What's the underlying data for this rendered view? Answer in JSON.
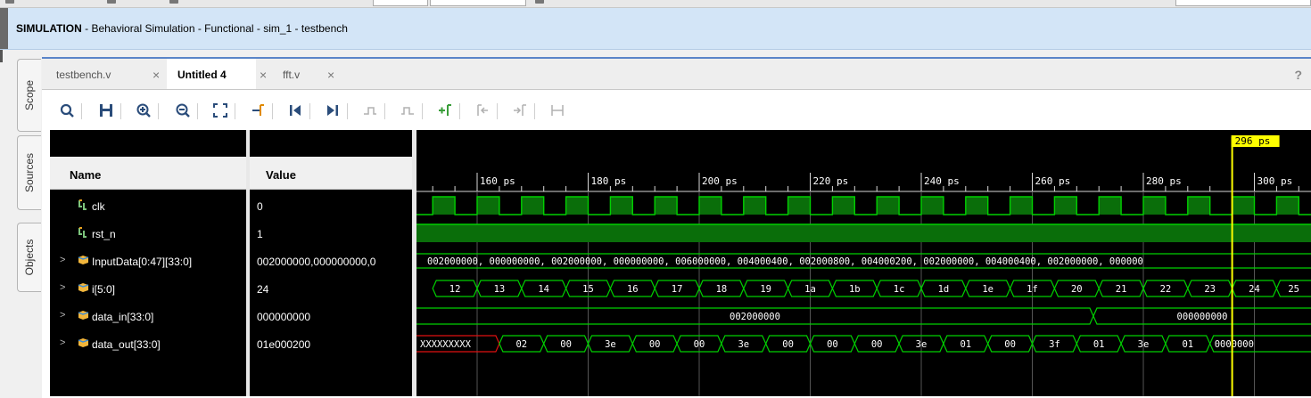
{
  "header": {
    "title_bold": "SIMULATION",
    "title_rest": " - Behavioral Simulation - Functional - sim_1 - testbench"
  },
  "side_tabs": [
    "Scope",
    "Sources",
    "Objects"
  ],
  "tabs": [
    {
      "label": "testbench.v",
      "active": false
    },
    {
      "label": "Untitled 4",
      "active": true
    },
    {
      "label": "fft.v",
      "active": false
    }
  ],
  "tab_close_glyph": "×",
  "help_glyph": "?",
  "toolbar_icons": [
    "search-icon",
    "save-icon",
    "zoom-in-icon",
    "zoom-out-icon",
    "zoom-fit-icon",
    "go-to-cursor-icon",
    "go-to-time-zero-icon",
    "go-to-last-time-icon",
    "previous-transition-icon",
    "next-transition-icon",
    "add-marker-icon",
    "previous-marker-icon",
    "next-marker-icon",
    "swap-cursors-icon"
  ],
  "columns": {
    "name": "Name",
    "value": "Value"
  },
  "signals": [
    {
      "name": "clk",
      "value": "0",
      "expandable": false,
      "icon": "bit-signal-icon"
    },
    {
      "name": "rst_n",
      "value": "1",
      "expandable": false,
      "icon": "bit-signal-icon"
    },
    {
      "name": "InputData[0:47][33:0]",
      "value": "002000000,000000000,0",
      "expandable": true,
      "icon": "bus-signal-icon"
    },
    {
      "name": "i[5:0]",
      "value": "24",
      "expandable": true,
      "icon": "bus-signal-icon"
    },
    {
      "name": "data_in[33:0]",
      "value": "000000000",
      "expandable": true,
      "icon": "bus-signal-icon"
    },
    {
      "name": "data_out[33:0]",
      "value": "01e000200",
      "expandable": true,
      "icon": "bus-signal-icon"
    }
  ],
  "waveform": {
    "time_labels": [
      "160 ps",
      "180 ps",
      "200 ps",
      "220 ps",
      "240 ps",
      "260 ps",
      "280 ps",
      "300 ps"
    ],
    "cursor_label": "296 ps",
    "cursor_time_ps": 296,
    "inputdata_text": "002000000, 000000000, 002000000, 000000000, 006000000, 004000400, 002000800, 004000200, 002000000, 004000400, 002000000, 000000",
    "i_values": [
      "12",
      "13",
      "14",
      "15",
      "16",
      "17",
      "18",
      "19",
      "1a",
      "1b",
      "1c",
      "1d",
      "1e",
      "1f",
      "20",
      "21",
      "22",
      "23",
      "24",
      "25"
    ],
    "data_in_values": [
      "002000000",
      "000000000"
    ],
    "data_out_values": [
      "XXXXXXXXX",
      "02",
      "00",
      "3e",
      "00",
      "00",
      "3e",
      "00",
      "00",
      "00",
      "3e",
      "01",
      "00",
      "3f",
      "01",
      "3e",
      "01",
      "0000000"
    ]
  },
  "colors": {
    "wave": "#00d000",
    "wave_fill": "#0a6e0a",
    "cursor": "#ffff00",
    "undefined": "#e01010",
    "header_bg": "#d3e5f7"
  }
}
